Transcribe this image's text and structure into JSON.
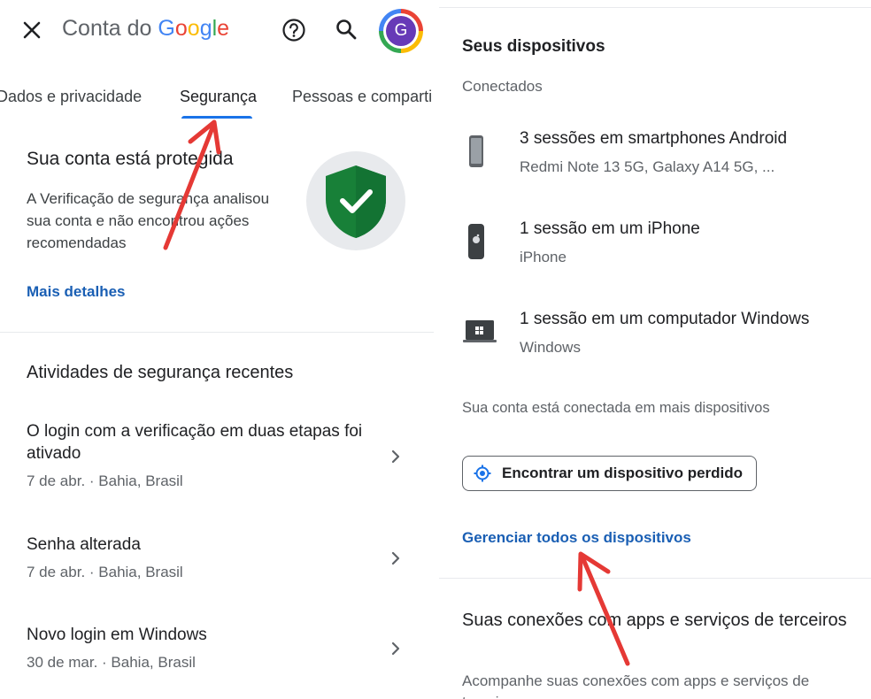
{
  "header": {
    "title_prefix": "Conta do",
    "logo_letters": [
      "G",
      "o",
      "o",
      "g",
      "l",
      "e"
    ],
    "logo_colors": [
      "#4285f4",
      "#ea4335",
      "#fbbc05",
      "#4285f4",
      "#34a853",
      "#ea4335"
    ],
    "avatar_initial": "G"
  },
  "tabs": [
    {
      "label": "Dados e privacidade"
    },
    {
      "label": "Segurança",
      "selected": true
    },
    {
      "label": "Pessoas e comparti"
    }
  ],
  "security_status": {
    "title": "Sua conta está protegida",
    "description": "A Verificação de segurança analisou sua conta e não encontrou ações recomendadas",
    "link": "Mais detalhes"
  },
  "recent_activity": {
    "title": "Atividades de segurança recentes",
    "items": [
      {
        "title": "O login com a verificação em duas etapas foi ativado",
        "meta": "7 de abr. · Bahia, Brasil"
      },
      {
        "title": "Senha alterada",
        "meta": "7 de abr. · Bahia, Brasil"
      },
      {
        "title": "Novo login em Windows",
        "meta": "30 de mar. · Bahia, Brasil"
      }
    ]
  },
  "devices": {
    "title": "Seus dispositivos",
    "subtitle": "Conectados",
    "items": [
      {
        "title": "3 sessões em smartphones Android",
        "sub": "Redmi Note 13 5G, Galaxy A14 5G, ...",
        "icon": "android-phone-icon"
      },
      {
        "title": "1 sessão em um iPhone",
        "sub": "iPhone",
        "icon": "iphone-icon"
      },
      {
        "title": "1 sessão em um computador Windows",
        "sub": "Windows",
        "icon": "windows-laptop-icon"
      }
    ],
    "more_text": "Sua conta está conectada em mais dispositivos",
    "find_button": "Encontrar um dispositivo perdido",
    "manage_link": "Gerenciar todos os dispositivos"
  },
  "connections": {
    "title": "Suas conexões com apps e serviços de terceiros",
    "description": "Acompanhe suas conexões com apps e serviços de terceiros"
  },
  "colors": {
    "accent": "#1a73e8",
    "link": "#1a5fb4",
    "shield": "#188038",
    "annotation_arrow": "#e53935"
  }
}
